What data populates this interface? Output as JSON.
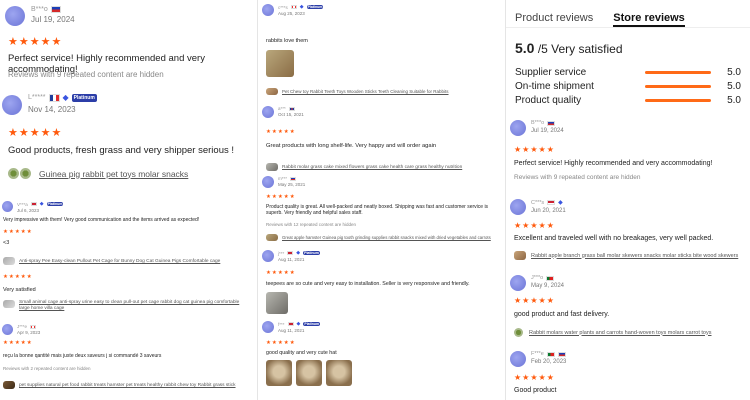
{
  "tabs": {
    "product": "Product reviews",
    "store": "Store reviews"
  },
  "store_score": {
    "value": "5.0",
    "suffix": "/5 Very satisfied"
  },
  "ratings": [
    {
      "label": "Supplier service",
      "value": "5.0",
      "fill": 1.0
    },
    {
      "label": "On-time shipment",
      "value": "5.0",
      "fill": 1.0
    },
    {
      "label": "Product quality",
      "value": "5.0",
      "fill": 1.0
    }
  ],
  "stars": "★★★★★",
  "platinum_label": "Platinum",
  "col1": {
    "r1": {
      "user": "B***o",
      "date": "Jul 19, 2024",
      "text": "Perfect service! Highly recommended and very accommodating!",
      "hidden": "Reviews with 9 repeated content are hidden"
    },
    "r2": {
      "user": "L*****",
      "date": "Nov 14, 2023",
      "text": "Good products, fresh grass and very shipper serious !",
      "product": "Guinea pig rabbit pet toys molar snacks"
    },
    "r3": {
      "user": "V***a",
      "date": "Jul 6, 2023",
      "text": "Very impressive with them! Very good communication and the items arrived as expected!",
      "extra": "<3",
      "product": "Anti-spray Pee Easy-clean Pullout Pet Cage for Bunny Dog Cat Guinea Pigs Comfortable cage"
    },
    "r4": {
      "text": "Very satisfied",
      "product": "Small animal cage anti-spray urine easy to clean pull-out pet cage rabbit dog cat guinea pig comfortable large home villa cage"
    },
    "r5": {
      "user": "J***e",
      "date": "Apr 9, 2023",
      "text": "reçu la bonne qantité mais juste deux saveurs j si commandé 3 saveurs",
      "hidden": "Reviews with 2 repeated content are hidden",
      "product": "pet supplies natural pet food rabbit treats hamster pet treats healthy rabbit chew toy Rabbit grass stick"
    }
  },
  "col2": {
    "r1": {
      "user": "c***s",
      "date": "Aug 25, 2023",
      "text": "rabbits love them",
      "product": "Pet Chew toy Rabbit Teeth Toys Wooden Sticks Teeth Cleaning Suitable for Rabbits"
    },
    "r2": {
      "user": "a***",
      "date": "Oct 15, 2021",
      "text": "Great products with long shelf-life. Very happy and will order again",
      "product": "Rabbit molar grass cake mixed flowers grass cake health care grass healthy nutrition"
    },
    "r3": {
      "user": "m***",
      "date": "May 25, 2021",
      "text": "Product quality is great. All well-packed and neatly boxed. Shipping was fast and customer service is superb. Very friendly and helpful sales staff.",
      "hidden": "Reviews with 12 repeated content are hidden",
      "product": "Great apple hamster Guinea pig tooth grinding supplies rabbit snacks mixed with dried vegetables and carrots"
    },
    "r4": {
      "user": "j***",
      "date": "Aug 11, 2021",
      "text": "teepees are so cute and very easy to installation. Seller is very responsive and friendly."
    },
    "r5": {
      "user": "f***",
      "date": "Aug 11, 2021",
      "text": "good quality and very cute hat"
    }
  },
  "col3": {
    "r1": {
      "user": "B***o",
      "date": "Jul 19, 2024",
      "text": "Perfect service! Highly recommended and very accommodating!",
      "hidden": "Reviews with 9 repeated content are hidden"
    },
    "r2": {
      "user": "C***s",
      "date": "Jun 20, 2021",
      "text": "Excellent and traveled well with no breakages, very well packed.",
      "product": "Rabbit apple branch grass ball molar skewers snacks molar sticks bite wood skewers"
    },
    "r3": {
      "user": "J***o",
      "date": "May 9, 2024",
      "text": "good product and fast delivery.",
      "product": "Rabbit molars water plants and carrots hand-woven toys molars carrot toys"
    },
    "r4": {
      "user": "F***e",
      "date": "Feb 20, 2023",
      "text": "Good product"
    }
  }
}
